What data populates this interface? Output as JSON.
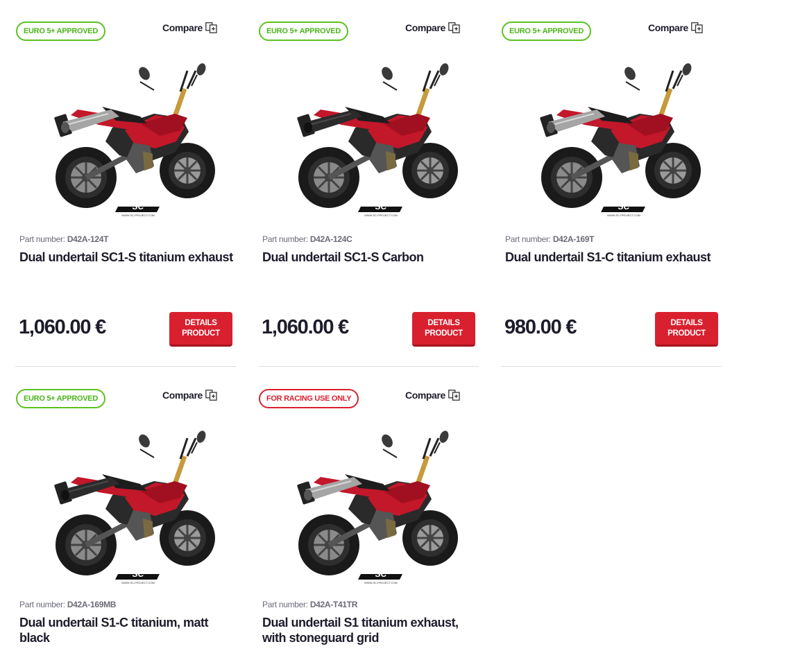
{
  "compare_label": "Compare",
  "part_number_label": "Part number:",
  "details_label_line1": "DETAILS",
  "details_label_line2": "PRODUCT",
  "colors": {
    "approved_green": "#5bc21f",
    "racing_red": "#d9202f",
    "button_red": "#d9202f",
    "bike_red": "#c3172a"
  },
  "products": [
    {
      "badge": "EURO 5+ APPROVED",
      "badge_type": "approved",
      "part_number": "D42A-124T",
      "title": "Dual undertail SC1-S titanium exhaust",
      "price": "1,060.00 €",
      "exhaust": "titanium"
    },
    {
      "badge": "EURO 5+ APPROVED",
      "badge_type": "approved",
      "part_number": "D42A-124C",
      "title": "Dual undertail SC1-S Carbon",
      "price": "1,060.00 €",
      "exhaust": "carbon"
    },
    {
      "badge": "EURO 5+ APPROVED",
      "badge_type": "approved",
      "part_number": "D42A-169T",
      "title": "Dual undertail S1-C titanium exhaust",
      "price": "980.00 €",
      "exhaust": "titanium"
    },
    {
      "badge": "EURO 5+ APPROVED",
      "badge_type": "approved",
      "part_number": "D42A-169MB",
      "title": "Dual undertail S1-C titanium, matt black",
      "exhaust": "black"
    },
    {
      "badge": "FOR RACING USE ONLY",
      "badge_type": "racing",
      "part_number": "D42A-T41TR",
      "title": "Dual undertail S1 titanium exhaust, with stoneguard grid",
      "exhaust": "titanium"
    }
  ]
}
